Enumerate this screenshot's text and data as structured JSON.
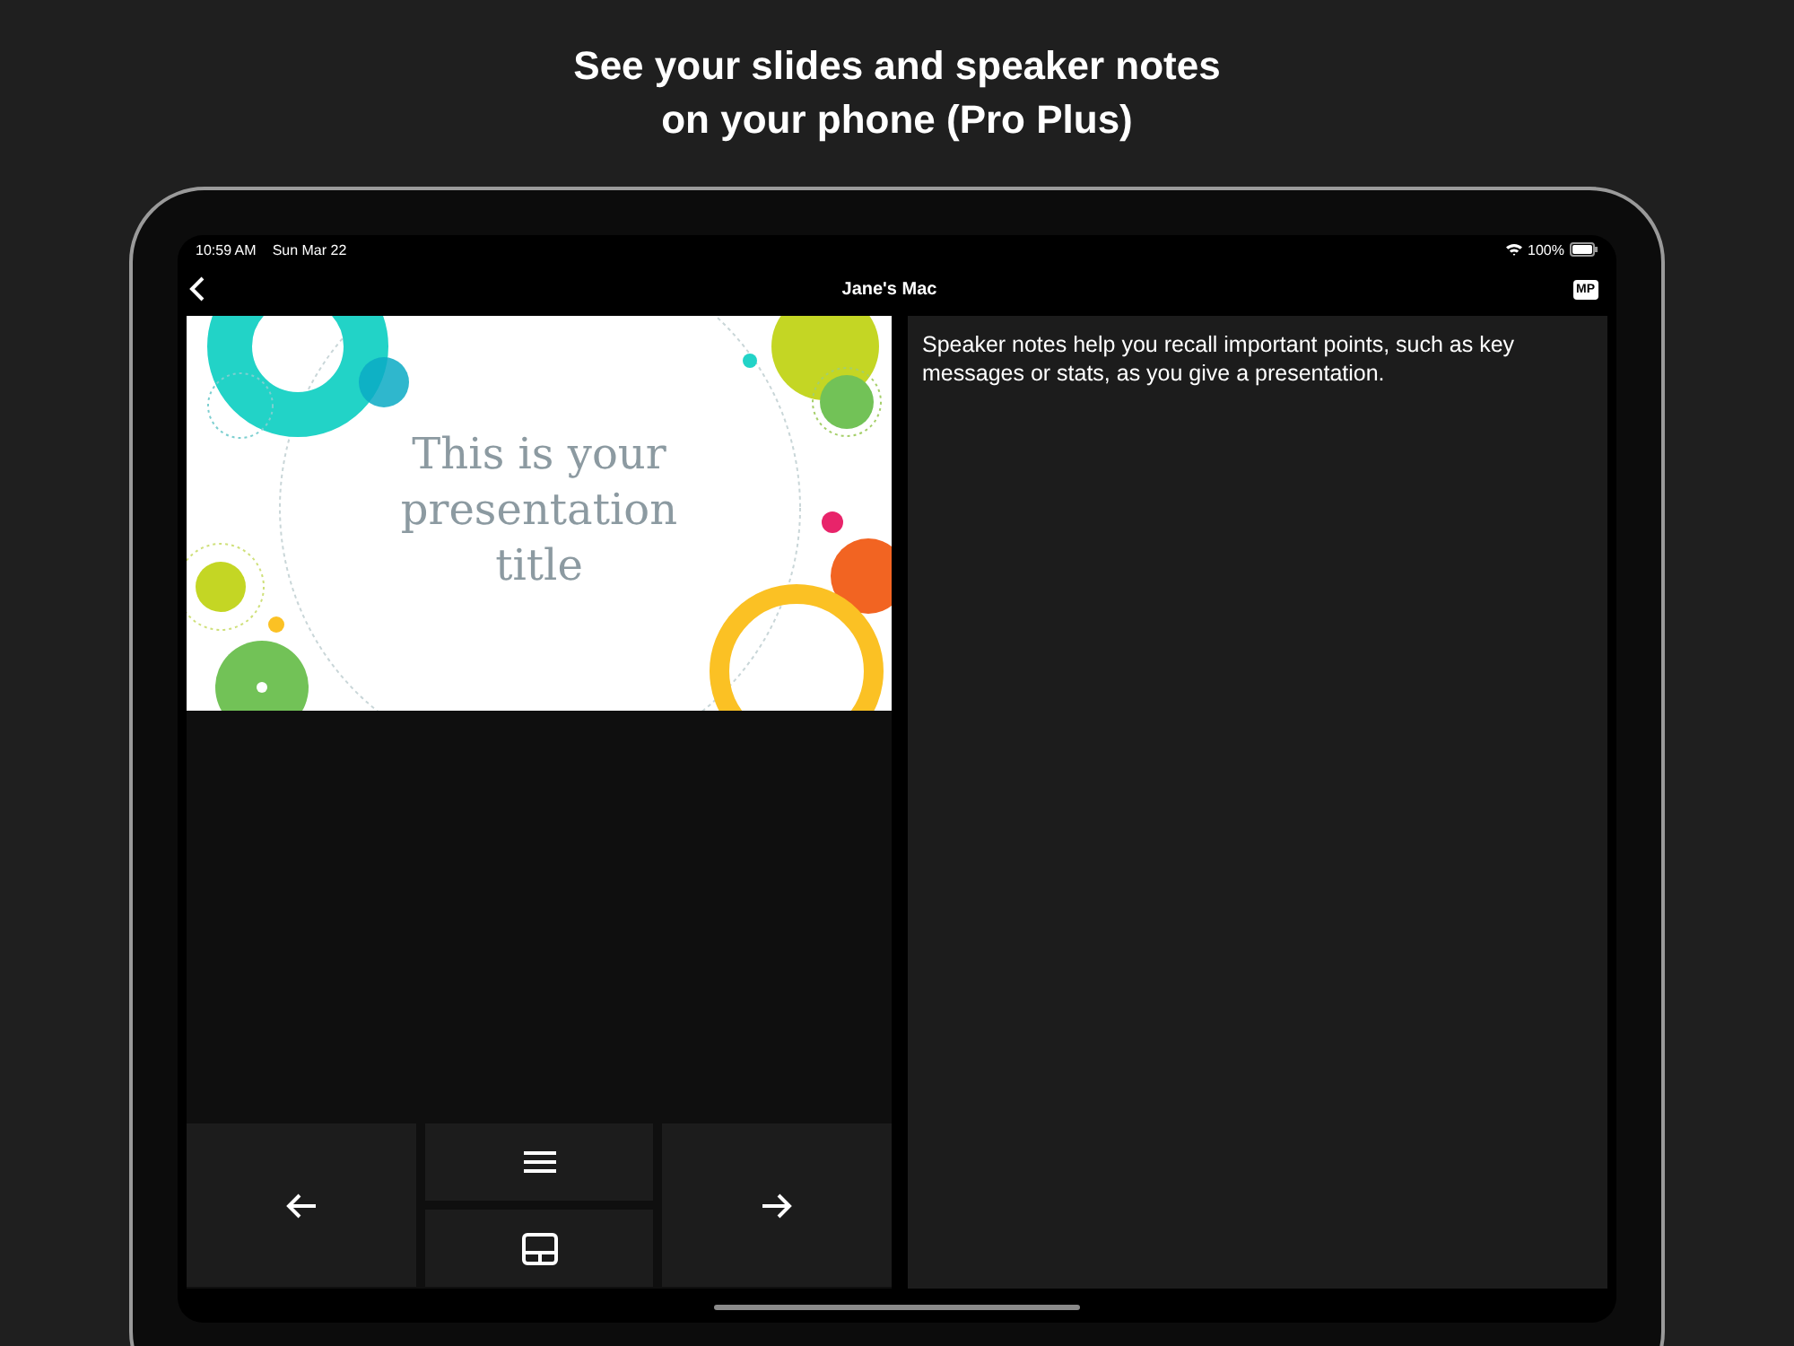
{
  "headline": [
    "See your slides and speaker notes",
    "on your phone (Pro Plus)"
  ],
  "status_bar": {
    "time": "10:59 AM",
    "date": "Sun Mar 22",
    "battery": "100%"
  },
  "nav": {
    "title": "Jane's Mac",
    "badge": "MP"
  },
  "slide": {
    "title": "This is your presentation title"
  },
  "notes": "Speaker notes help you recall important points, such as key messages or stats, as you give a presentation."
}
